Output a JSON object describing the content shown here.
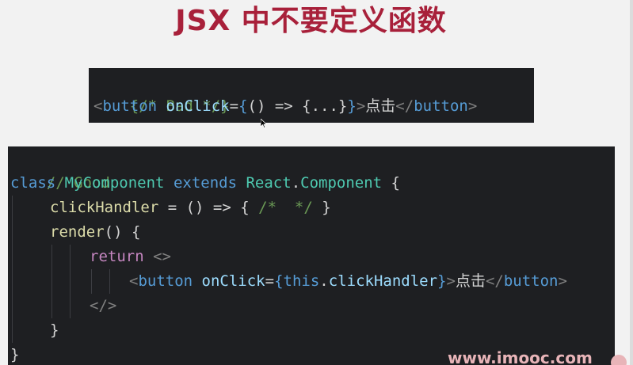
{
  "title": "JSX 中不要定义函数",
  "bad_snippet": {
    "comment": "{/* Bad */}",
    "line2": {
      "tag_open": "<",
      "tag_name": "button",
      "attr": "onClick",
      "eq": "=",
      "brace_open": "{",
      "arrow_fn": "() => ",
      "body": "{...}",
      "brace_close": "}",
      "gt": ">",
      "text": "点击",
      "close_tag_open": "</",
      "close_tag_name": "button",
      "close_gt": ">"
    }
  },
  "good_snippet": {
    "comment": "// Good",
    "class_kw": "class",
    "class_name": "MyComponent",
    "extends_kw": "extends",
    "base_obj": "React",
    "dot": ".",
    "base_class": "Component",
    "open_brace": "{",
    "handler_name": "clickHandler",
    "handler_eq": " = ",
    "handler_arrow": "() => ",
    "handler_body_open": "{ ",
    "handler_comment": "/*  */",
    "handler_body_close": " }",
    "render_name": "render",
    "render_parens": "() {",
    "return_kw": "return",
    "fragment_open": "<>",
    "btn_lt": "<",
    "btn_name": "button",
    "btn_attr": "onClick",
    "btn_eq": "=",
    "btn_brace_open": "{",
    "btn_this": "this",
    "btn_dot": ".",
    "btn_handler": "clickHandler",
    "btn_brace_close": "}",
    "btn_gt": ">",
    "btn_text": "点击",
    "btn_close_lt": "</",
    "btn_close_name": "button",
    "btn_close_gt": ">",
    "fragment_close": "</>",
    "render_close": "}",
    "class_close": "}"
  },
  "watermark": "www.imooc.com",
  "colors": {
    "title": "#a8203a",
    "code_bg": "#1e1f22",
    "page_bg": "#f2f2f2"
  },
  "icons": {
    "cursor": "mouse-pointer-icon",
    "logo": "imooc-logo-icon"
  }
}
